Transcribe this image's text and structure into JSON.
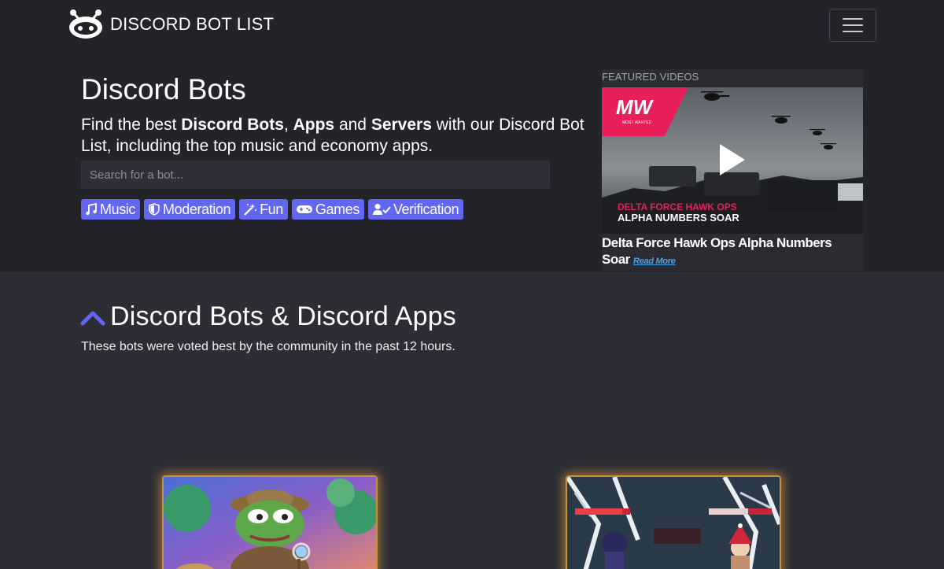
{
  "header": {
    "brand": "DISCORD BOT LIST",
    "menu_icon": "hamburger-icon",
    "logo_icon": "robot-face-icon"
  },
  "hero": {
    "title": "Discord Bots",
    "subtitle": {
      "t1": "Find the best ",
      "b1": "Discord Bots",
      "t2": ", ",
      "b2": "Apps",
      "t3": " and ",
      "b3": "Servers",
      "t4": " with our Discord Bot List, including the top music and economy apps."
    },
    "search_placeholder": "Search for a bot...",
    "tags": [
      {
        "label": "Music",
        "icon": "music-note-icon"
      },
      {
        "label": "Moderation",
        "icon": "shield-icon"
      },
      {
        "label": "Fun",
        "icon": "magic-wand-icon"
      },
      {
        "label": "Games",
        "icon": "gamepad-icon"
      },
      {
        "label": "Verification",
        "icon": "user-check-icon"
      }
    ]
  },
  "featured": {
    "label": "FEATURED VIDEOS",
    "thumb_logo": "MW",
    "thumb_logo_sub": "MOST WANTED",
    "thumb_line1": "DELTA FORCE HAWK OPS",
    "thumb_line2": "ALPHA NUMBERS SOAR",
    "title": "Delta Force Hawk Ops Alpha Numbers Soar",
    "read_more": "Read More",
    "play_icon": "play-icon"
  },
  "section": {
    "title": "Discord Bots & Discord Apps",
    "icon": "chevron-up-icon",
    "description": "These bots were voted best by the community in the past 12 hours."
  },
  "colors": {
    "accent": "#6366f1",
    "header_bg": "#23242a",
    "page_bg": "#2d2e35",
    "card_glow": "#e8a03c",
    "link": "#4aa3e8"
  }
}
